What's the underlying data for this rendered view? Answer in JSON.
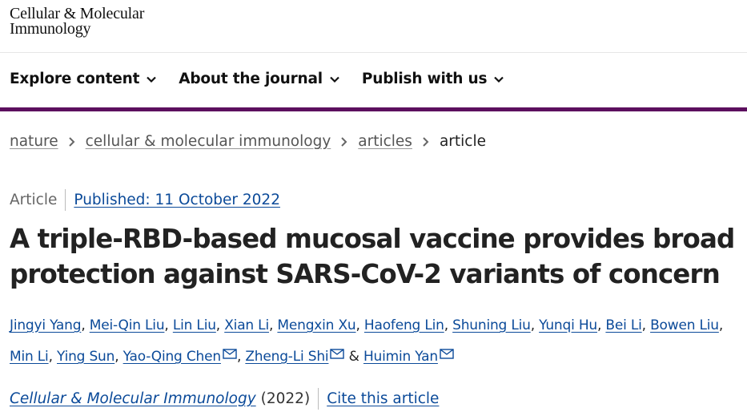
{
  "logo": {
    "line1": "Cellular & Molecular",
    "line2": "Immunology"
  },
  "nav": {
    "items": [
      "Explore content",
      "About the journal",
      "Publish with us"
    ]
  },
  "breadcrumb": {
    "items": [
      "nature",
      "cellular & molecular immunology",
      "articles"
    ],
    "current": "article"
  },
  "article": {
    "type": "Article",
    "published": "Published: 11 October 2022",
    "title": "A triple-RBD-based mucosal vaccine provides broad protection against SARS-CoV-2 variants of concern",
    "authors": [
      "Jingyi Yang",
      "Mei-Qin Liu",
      "Lin Liu",
      "Xian Li",
      "Mengxin Xu",
      "Haofeng Lin",
      "Shuning Liu",
      "Yunqi Hu",
      "Bei Li",
      "Bowen Liu",
      "Min Li",
      "Ying Sun",
      "Yao-Qing Chen",
      "Zheng-Li Shi",
      "Huimin Yan"
    ],
    "conjunction": "&",
    "journal": "Cellular & Molecular Immunology",
    "year": "(2022)",
    "cite_label": "Cite this article"
  },
  "colors": {
    "accent_bar": "#5c0f5e",
    "link": "#0b4a99"
  }
}
